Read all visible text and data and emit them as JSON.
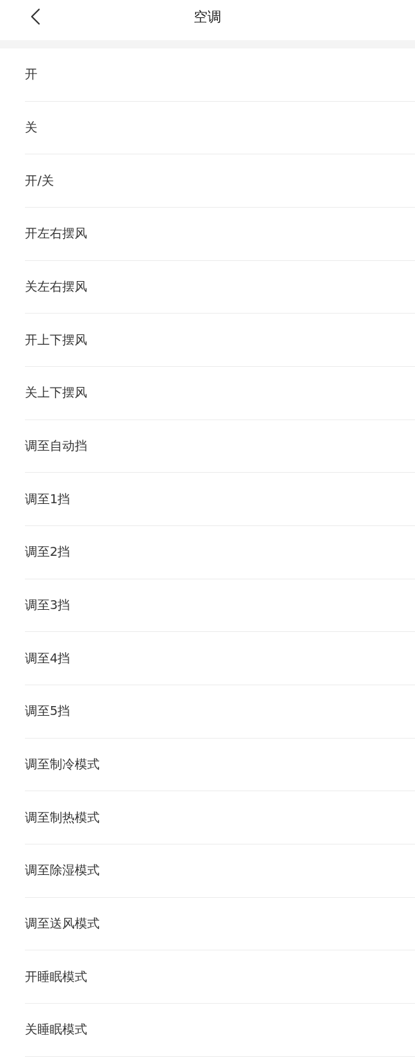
{
  "header": {
    "title": "空调"
  },
  "items": [
    {
      "label": "开"
    },
    {
      "label": "关"
    },
    {
      "label": "开/关"
    },
    {
      "label": "开左右摆风"
    },
    {
      "label": "关左右摆风"
    },
    {
      "label": "开上下摆风"
    },
    {
      "label": "关上下摆风"
    },
    {
      "label": "调至自动挡"
    },
    {
      "label": "调至1挡"
    },
    {
      "label": "调至2挡"
    },
    {
      "label": "调至3挡"
    },
    {
      "label": "调至4挡"
    },
    {
      "label": "调至5挡"
    },
    {
      "label": "调至制冷模式"
    },
    {
      "label": "调至制热模式"
    },
    {
      "label": "调至除湿模式"
    },
    {
      "label": "调至送风模式"
    },
    {
      "label": "开睡眠模式"
    },
    {
      "label": "关睡眠模式"
    }
  ]
}
